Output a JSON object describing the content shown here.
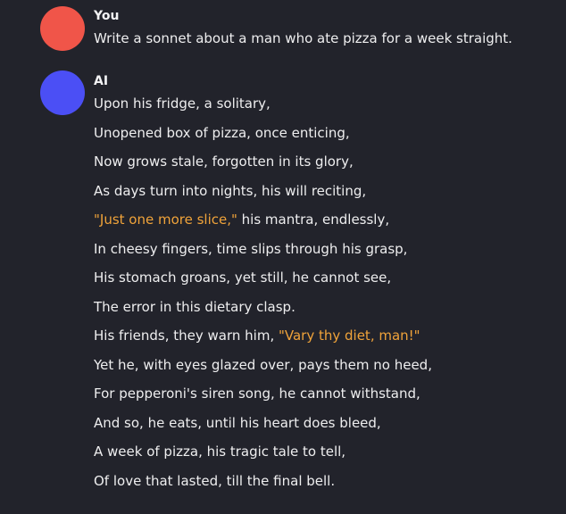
{
  "chat": {
    "messages": [
      {
        "sender": "You",
        "avatar_color": "#f05549",
        "text": "Write a sonnet about a man who ate pizza for a week straight."
      },
      {
        "sender": "AI",
        "avatar_color": "#4b4ff5",
        "lines": [
          {
            "text": "Upon his fridge, a solitary,"
          },
          {
            "text": "Unopened box of pizza, once enticing,"
          },
          {
            "text": "Now grows stale, forgotten in its glory,"
          },
          {
            "text": "As days turn into nights, his will reciting,"
          },
          {
            "quote": "\"Just one more slice,\"",
            "after": " his mantra, endlessly,"
          },
          {
            "text": "In cheesy fingers, time slips through his grasp,"
          },
          {
            "text": "His stomach groans, yet still, he cannot see,"
          },
          {
            "text": "The error in this dietary clasp."
          },
          {
            "before": "His friends, they warn him, ",
            "quote": "\"Vary thy diet, man!\""
          },
          {
            "text": "Yet he, with eyes glazed over, pays them no heed,"
          },
          {
            "text": "For pepperoni's siren song, he cannot withstand,"
          },
          {
            "text": "And so, he eats, until his heart does bleed,"
          },
          {
            "text": "A week of pizza, his tragic tale to tell,"
          },
          {
            "text": "Of love that lasted, till the final bell."
          }
        ]
      }
    ]
  },
  "colors": {
    "background": "#22232b",
    "quote_highlight": "#f0a33a"
  }
}
